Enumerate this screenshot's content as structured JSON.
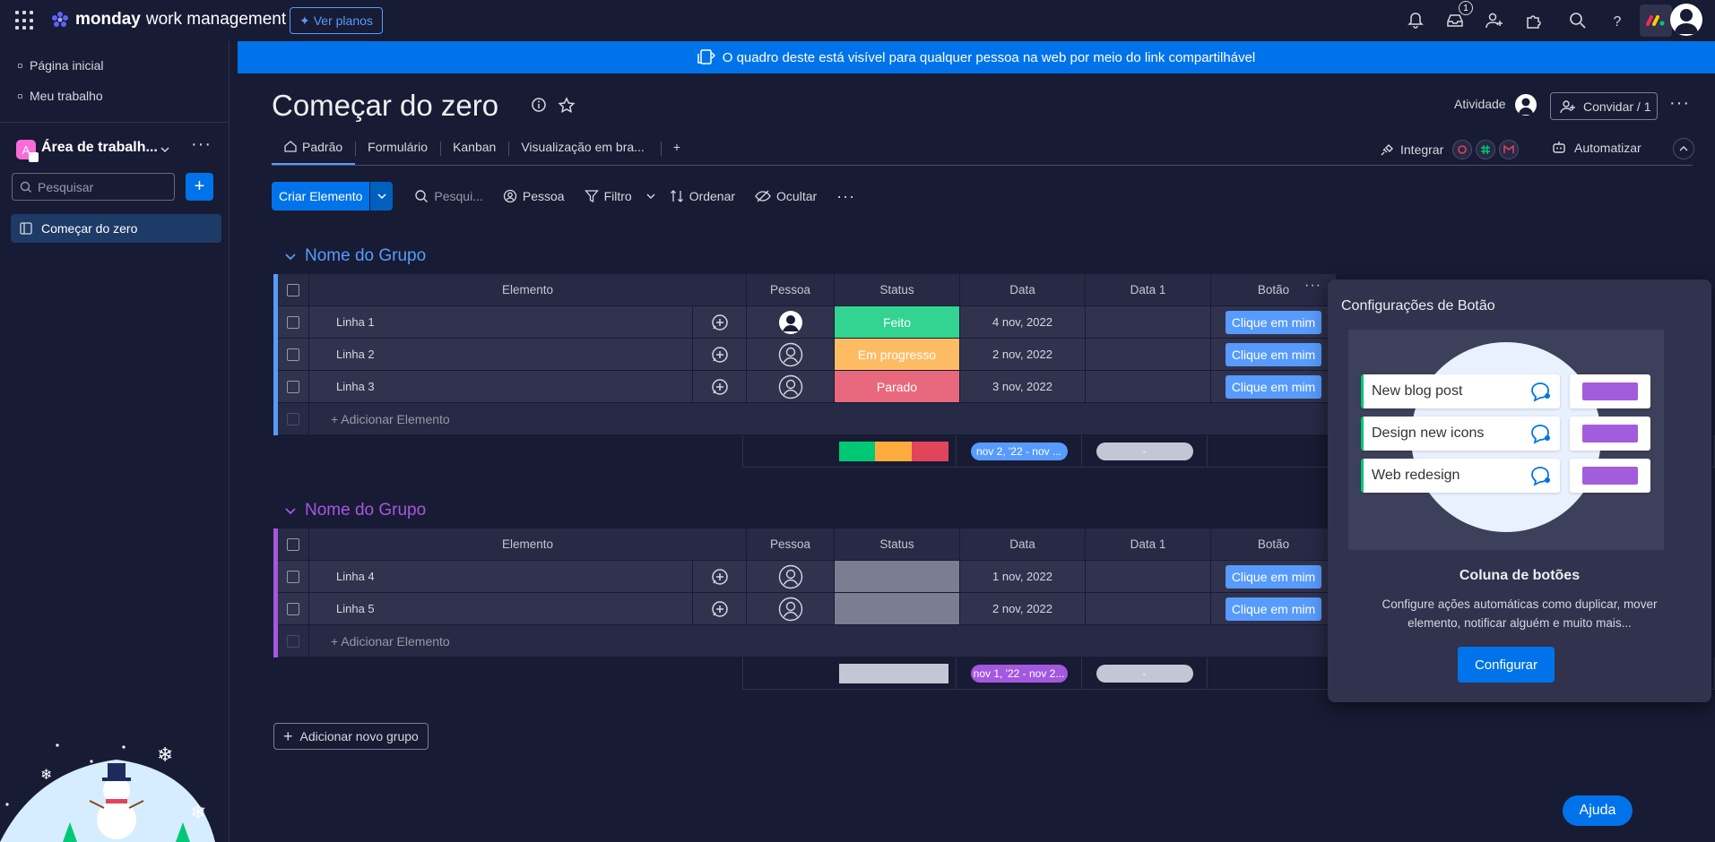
{
  "topbar": {
    "brand_bold": "monday",
    "brand_sub": "work management",
    "plans_label": "Ver planos",
    "inbox_badge": "1"
  },
  "sidebar": {
    "home": "Página inicial",
    "my_work": "Meu trabalho",
    "workspace_initial": "A",
    "workspace_name": "Área de trabalh...",
    "search_placeholder": "Pesquisar",
    "board_item": "Começar do zero"
  },
  "banner": {
    "text": "O quadro deste está visível para qualquer pessoa na web por meio do link compartilhável"
  },
  "board": {
    "title": "Começar do zero",
    "activity_label": "Atividade",
    "invite_label": "Convidar / 1",
    "tabs": [
      "Padrão",
      "Formulário",
      "Kanban",
      "Visualização em bra..."
    ],
    "integrate_label": "Integrar",
    "automate_label": "Automatizar"
  },
  "toolbar": {
    "new_item": "Criar Elemento",
    "search": "Pesqui...",
    "person": "Pessoa",
    "filter": "Filtro",
    "sort": "Ordenar",
    "hide": "Ocultar"
  },
  "columns": {
    "item": "Elemento",
    "person": "Pessoa",
    "status": "Status",
    "date": "Data",
    "date1": "Data 1",
    "button": "Botão"
  },
  "groups": [
    {
      "name": "Nome do Grupo",
      "color": "#579bfc",
      "rows": [
        {
          "name": "Linha 1",
          "status": "Feito",
          "status_color": "#33d391",
          "date": "4 nov, 2022",
          "button": "Clique em mim"
        },
        {
          "name": "Linha 2",
          "status": "Em progresso",
          "status_color": "#fdbc64",
          "date": "2 nov, 2022",
          "button": "Clique em mim"
        },
        {
          "name": "Linha 3",
          "status": "Parado",
          "status_color": "#e8697d",
          "date": "3 nov, 2022",
          "button": "Clique em mim"
        }
      ],
      "add_item": "+ Adicionar Elemento",
      "summary_date": "nov 2, '22 - nov ...",
      "summary_date1": "-"
    },
    {
      "name": "Nome do Grupo",
      "color": "#a358df",
      "rows": [
        {
          "name": "Linha 4",
          "status": "",
          "status_color": "#797e93",
          "date": "1 nov, 2022",
          "button": "Clique em mim"
        },
        {
          "name": "Linha 5",
          "status": "",
          "status_color": "#797e93",
          "date": "2 nov, 2022",
          "button": "Clique em mim"
        }
      ],
      "add_item": "+ Adicionar Elemento",
      "summary_date": "nov 1, '22 - nov 2...",
      "summary_date1": "-"
    }
  ],
  "popover": {
    "title": "Configurações de Botão",
    "illu_items": [
      "New blog post",
      "Design new icons",
      "Web redesign"
    ],
    "heading": "Coluna de botões",
    "description": "Configure ações automáticas como duplicar, mover elemento, notificar alguém e muito mais...",
    "button": "Configurar"
  },
  "add_group": "Adicionar novo grupo",
  "help": "Ajuda"
}
